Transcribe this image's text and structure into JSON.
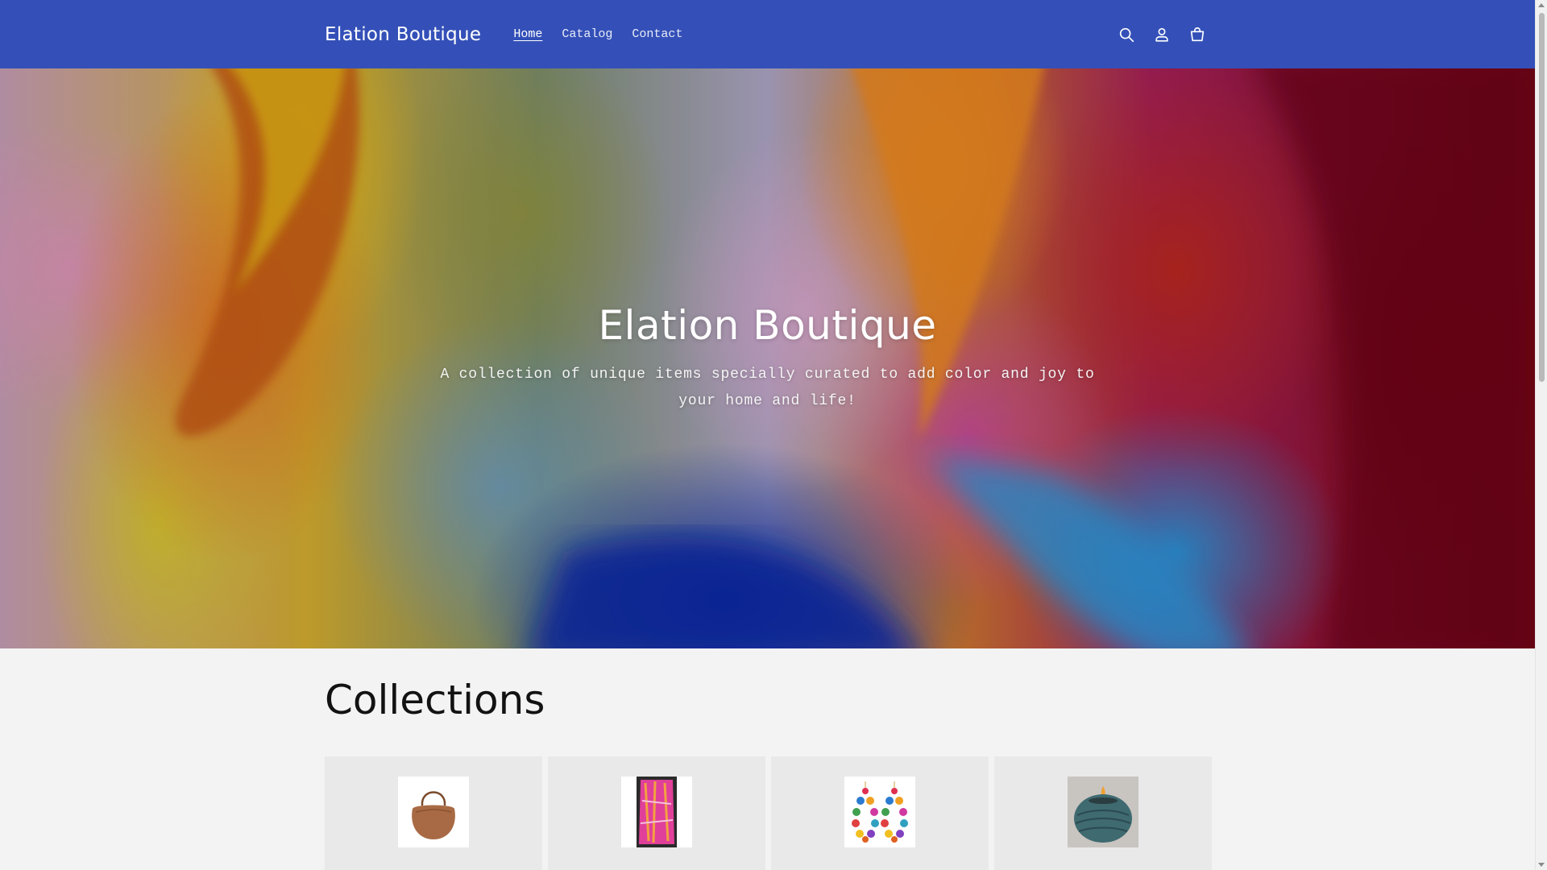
{
  "header": {
    "logo": "Elation Boutique",
    "nav": [
      {
        "label": "Home",
        "active": true
      },
      {
        "label": "Catalog",
        "active": false
      },
      {
        "label": "Contact",
        "active": false
      }
    ],
    "icons": [
      "search-icon",
      "account-icon",
      "cart-icon"
    ],
    "background_color": "#3450b8"
  },
  "hero": {
    "title": "Elation Boutique",
    "subtitle": "A collection of unique items specially curated to add color and joy to your home and life!"
  },
  "collections": {
    "heading": "Collections",
    "items": [
      {
        "image": "brown-handbag"
      },
      {
        "image": "pink-scarf"
      },
      {
        "image": "beaded-earrings"
      },
      {
        "image": "ceramic-candle"
      }
    ]
  }
}
